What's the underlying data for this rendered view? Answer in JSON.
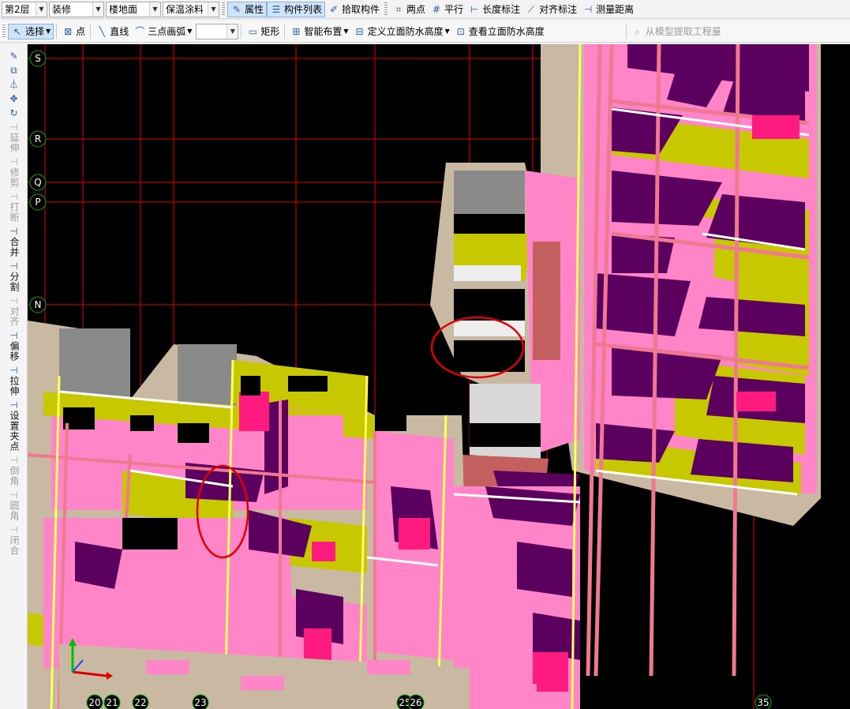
{
  "toolbar_top": {
    "floor": "第2层",
    "category": "装修",
    "component_type": "楼地面",
    "component_name": "保温涂料",
    "btn_properties": "属性",
    "btn_component_list": "构件列表",
    "btn_pick": "拾取构件",
    "btn_two_points": "两点",
    "btn_parallel": "平行",
    "btn_length_dim": "长度标注",
    "btn_align_dim": "对齐标注",
    "btn_measure": "测量距离"
  },
  "toolbar_draw": {
    "btn_select": "选择",
    "btn_point": "点",
    "btn_line": "直线",
    "btn_arc": "三点画弧",
    "arc_combo_value": "",
    "btn_rect": "矩形",
    "btn_smart": "智能布置",
    "btn_define_height": "定义立面防水高度",
    "btn_view_height": "查看立面防水高度",
    "btn_extract": "从模型提取工程量"
  },
  "left_tools": [
    {
      "label": "延伸",
      "icon": "extend-icon",
      "enabled": false
    },
    {
      "label": "修剪",
      "icon": "trim-icon",
      "enabled": false
    },
    {
      "label": "打断",
      "icon": "break-icon",
      "enabled": false
    },
    {
      "label": "合并",
      "icon": "merge-icon",
      "enabled": true
    },
    {
      "label": "分割",
      "icon": "split-icon",
      "enabled": true
    },
    {
      "label": "对齐",
      "icon": "align-icon",
      "enabled": false
    },
    {
      "label": "偏移",
      "icon": "offset-icon",
      "enabled": true
    },
    {
      "label": "拉伸",
      "icon": "stretch-icon",
      "enabled": true
    },
    {
      "label": "设置夹点",
      "icon": "grip-icon",
      "enabled": true
    },
    {
      "label": "倒角",
      "icon": "chamfer-icon",
      "enabled": false
    },
    {
      "label": "圆角",
      "icon": "fillet-icon",
      "enabled": false
    },
    {
      "label": "闭合",
      "icon": "close-icon",
      "enabled": false
    }
  ],
  "grid_axes": {
    "rows": [
      "S",
      "R",
      "Q",
      "P",
      "N"
    ],
    "cols": [
      "20",
      "21",
      "22",
      "23",
      "25",
      "26",
      "35"
    ]
  },
  "colors": {
    "slab": "#ff85c8",
    "wall_yellow": "#c8c800",
    "wall_purple": "#5c0060",
    "beam": "#f07890",
    "grid_line": "#e00000",
    "axis_bubble": "#00b000",
    "highlight_circle": "#e00000"
  }
}
